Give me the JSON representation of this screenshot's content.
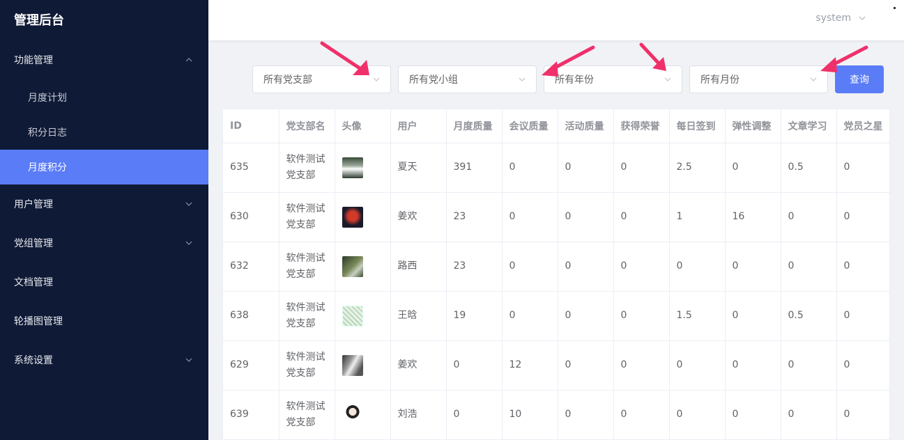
{
  "sidebar": {
    "brand": "管理后台",
    "groups": [
      {
        "label": "功能管理",
        "expanded": true,
        "items": [
          {
            "label": "月度计划",
            "active": false
          },
          {
            "label": "积分日志",
            "active": false
          },
          {
            "label": "月度积分",
            "active": true
          }
        ]
      },
      {
        "label": "用户管理",
        "expanded": false
      },
      {
        "label": "党组管理",
        "expanded": false
      },
      {
        "label": "文档管理"
      },
      {
        "label": "轮播图管理"
      },
      {
        "label": "系统设置",
        "expanded": false
      }
    ]
  },
  "header": {
    "user": "system"
  },
  "filters": {
    "branch": "所有党支部",
    "group": "所有党小组",
    "year": "所有年份",
    "month": "所有月份",
    "query_label": "查询"
  },
  "table": {
    "columns": [
      "ID",
      "党支部名",
      "头像",
      "用户",
      "月度质量",
      "会议质量",
      "活动质量",
      "获得荣誉",
      "每日签到",
      "弹性调整",
      "文章学习",
      "党员之星"
    ],
    "rows": [
      [
        "635",
        "软件测试\n党支部",
        "",
        "夏天",
        "391",
        "0",
        "0",
        "0",
        "2.5",
        "0",
        "0.5",
        "0"
      ],
      [
        "630",
        "软件测试\n党支部",
        "",
        "姜欢",
        "23",
        "0",
        "0",
        "0",
        "1",
        "16",
        "0",
        "0"
      ],
      [
        "632",
        "软件测试\n党支部",
        "",
        "路西",
        "23",
        "0",
        "0",
        "0",
        "0",
        "0",
        "0",
        "0"
      ],
      [
        "638",
        "软件测试\n党支部",
        "",
        "王晗",
        "19",
        "0",
        "0",
        "0",
        "1.5",
        "0",
        "0.5",
        "0"
      ],
      [
        "629",
        "软件测试\n党支部",
        "",
        "姜欢",
        "0",
        "12",
        "0",
        "0",
        "0",
        "0",
        "0",
        "0"
      ],
      [
        "639",
        "软件测试\n党支部",
        "",
        "刘浩",
        "0",
        "10",
        "0",
        "0",
        "0",
        "0",
        "0",
        "0"
      ]
    ]
  },
  "colors": {
    "sidebar_bg": "#0f1a36",
    "accent": "#5a7cf7",
    "annotation_arrow": "#f0306a"
  }
}
